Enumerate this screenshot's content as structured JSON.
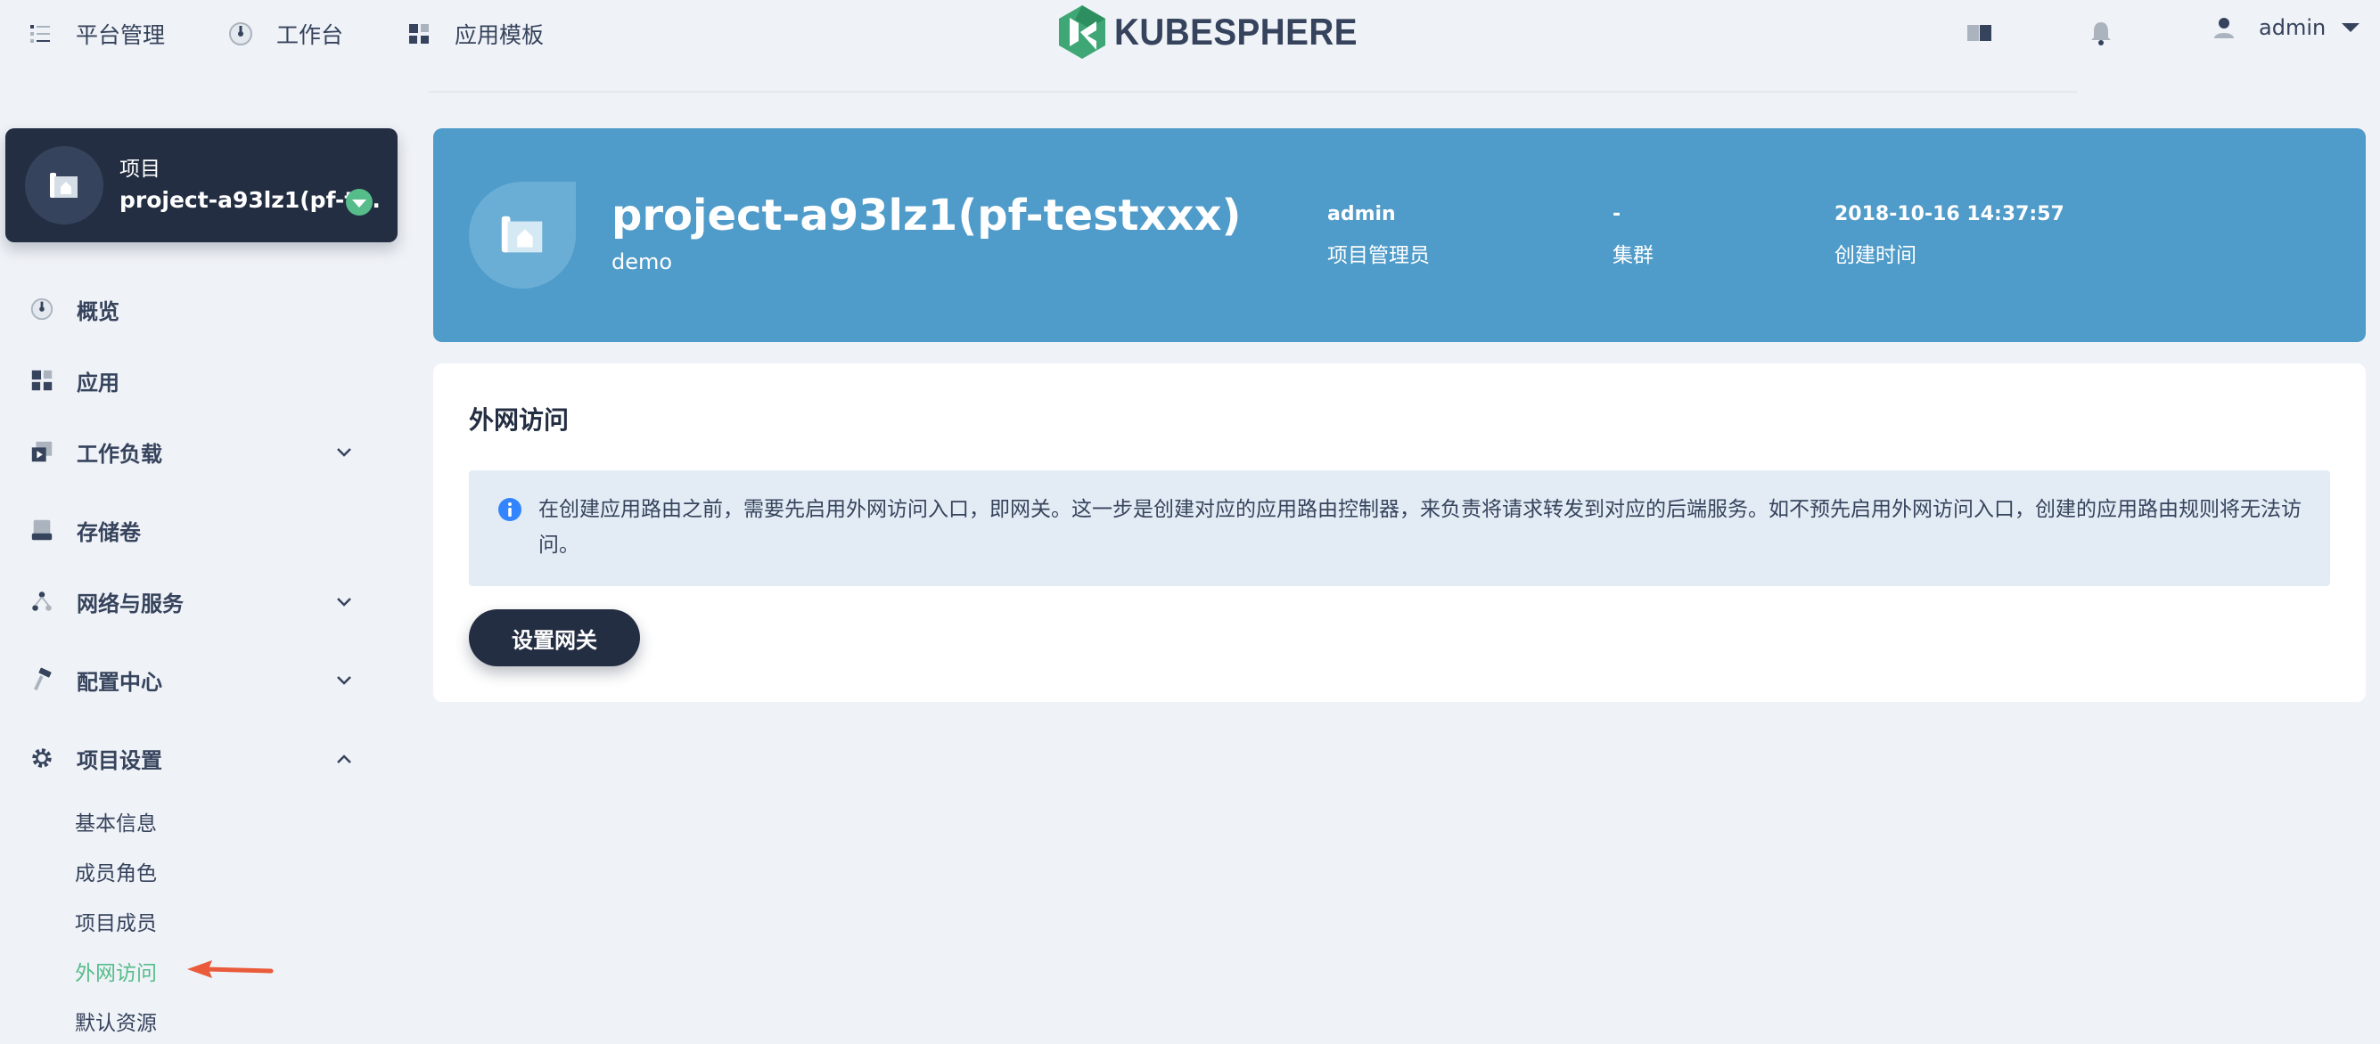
{
  "topnav": {
    "items": [
      {
        "label": "平台管理",
        "icon": "list-icon"
      },
      {
        "label": "工作台",
        "icon": "dashboard-icon"
      },
      {
        "label": "应用模板",
        "icon": "apps-icon"
      }
    ],
    "logo_text": "KUBESPHERE",
    "user": {
      "name": "admin"
    }
  },
  "project": {
    "type_label": "项目",
    "name": "project-a93lz1(pf-t..."
  },
  "sidebar": {
    "items": [
      {
        "label": "概览",
        "icon": "dashboard-icon"
      },
      {
        "label": "应用",
        "icon": "apps-icon"
      },
      {
        "label": "工作负载",
        "icon": "workload-icon"
      },
      {
        "label": "存储卷",
        "icon": "storage-icon"
      },
      {
        "label": "网络与服务",
        "icon": "network-icon"
      },
      {
        "label": "配置中心",
        "icon": "hammer-icon"
      },
      {
        "label": "项目设置",
        "icon": "gear-icon"
      }
    ],
    "sub_items": [
      {
        "label": "基本信息"
      },
      {
        "label": "成员角色"
      },
      {
        "label": "项目成员"
      },
      {
        "label": "外网访问",
        "active": true
      },
      {
        "label": "默认资源"
      }
    ]
  },
  "banner": {
    "title": "project-a93lz1(pf-testxxx)",
    "description": "demo",
    "stats": [
      {
        "value": "admin",
        "label": "项目管理员"
      },
      {
        "value": "-",
        "label": "集群"
      },
      {
        "value": "2018-10-16 14:37:57",
        "label": "创建时间"
      }
    ],
    "color": "#4f9bc9"
  },
  "gateway": {
    "title": "外网访问",
    "info": "在创建应用路由之前，需要先启用外网访问入口，即网关。这一步是创建对应的应用路由控制器，来负责将请求转发到对应的后端服务。如不预先启用外网访问入口，创建的应用路由规则将无法访问。",
    "button_label": "设置网关"
  },
  "colors": {
    "accent": "#55bc8a",
    "dark": "#242e42",
    "annotation": "#e95b3a"
  }
}
